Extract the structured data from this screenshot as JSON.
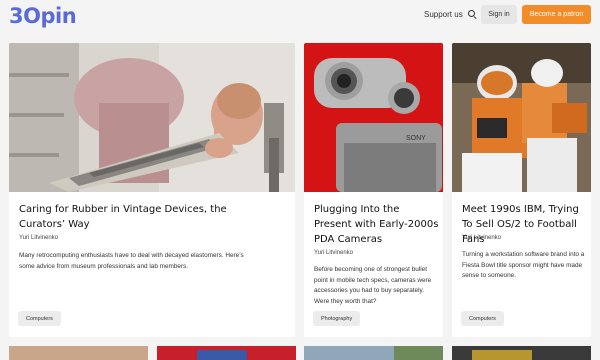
{
  "header": {
    "logo_text": "3Opin",
    "support_label": "Support us",
    "search_icon": "search-icon",
    "signin_label": "Sign in",
    "patron_label": "Become a patron",
    "colors": {
      "brand": "#5b6bd6",
      "accent": "#f28c28"
    }
  },
  "cards": [
    {
      "title": "Caring for Rubber in Vintage Devices, the Curators’ Way",
      "author": "Yuri Litvinenko",
      "description": "Many retrocomputing enthusiasts have to deal with decayed elastomers. Here’s some advice from museum professionals and lab members.",
      "tag": "Computers"
    },
    {
      "title": "Plugging Into the Present with Early-2000s PDA Cameras",
      "author": "Yuri Litvinenko",
      "description": "Before becoming one of strongest bullet point in mobile tech specs, cameras were accessories you had to buy separately. Were they worth that?",
      "tag": "Photography",
      "image_text": "SONY"
    },
    {
      "title": "Meet 1990s IBM, Trying To Sell OS/2 to Football Fans",
      "author": "Yuri Litvinenko",
      "description": "Turning a workstation software brand into a Fiesta Bowl title sponsor might have made sense to someone.",
      "tag": "Computers"
    }
  ]
}
